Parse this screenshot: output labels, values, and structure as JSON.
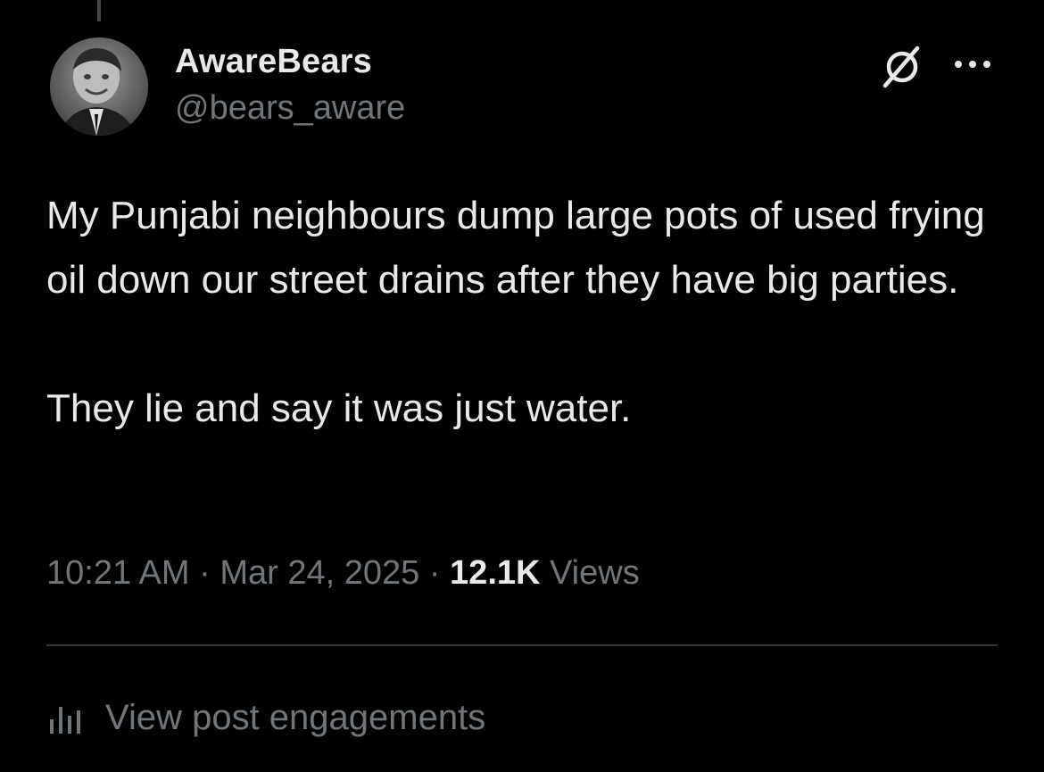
{
  "author": {
    "display_name": "AwareBears",
    "handle": "@bears_aware"
  },
  "post": {
    "paragraphs": [
      "My Punjabi neighbours dump large pots of used frying oil down our street drains after they have big parties.",
      "They lie and say it was just water."
    ],
    "time": "10:21 AM",
    "separator": "·",
    "date": "Mar 24, 2025",
    "views_count": "12.1K",
    "views_label": "Views"
  },
  "actions": {
    "engagements_label": "View post engagements"
  },
  "icons": {
    "grok": "grok-icon",
    "more": "more-icon",
    "engagements": "bar-chart-icon"
  },
  "colors": {
    "background": "#000000",
    "primary_text": "#e7e9ea",
    "secondary_text": "#71767b",
    "divider": "#2f3336"
  }
}
